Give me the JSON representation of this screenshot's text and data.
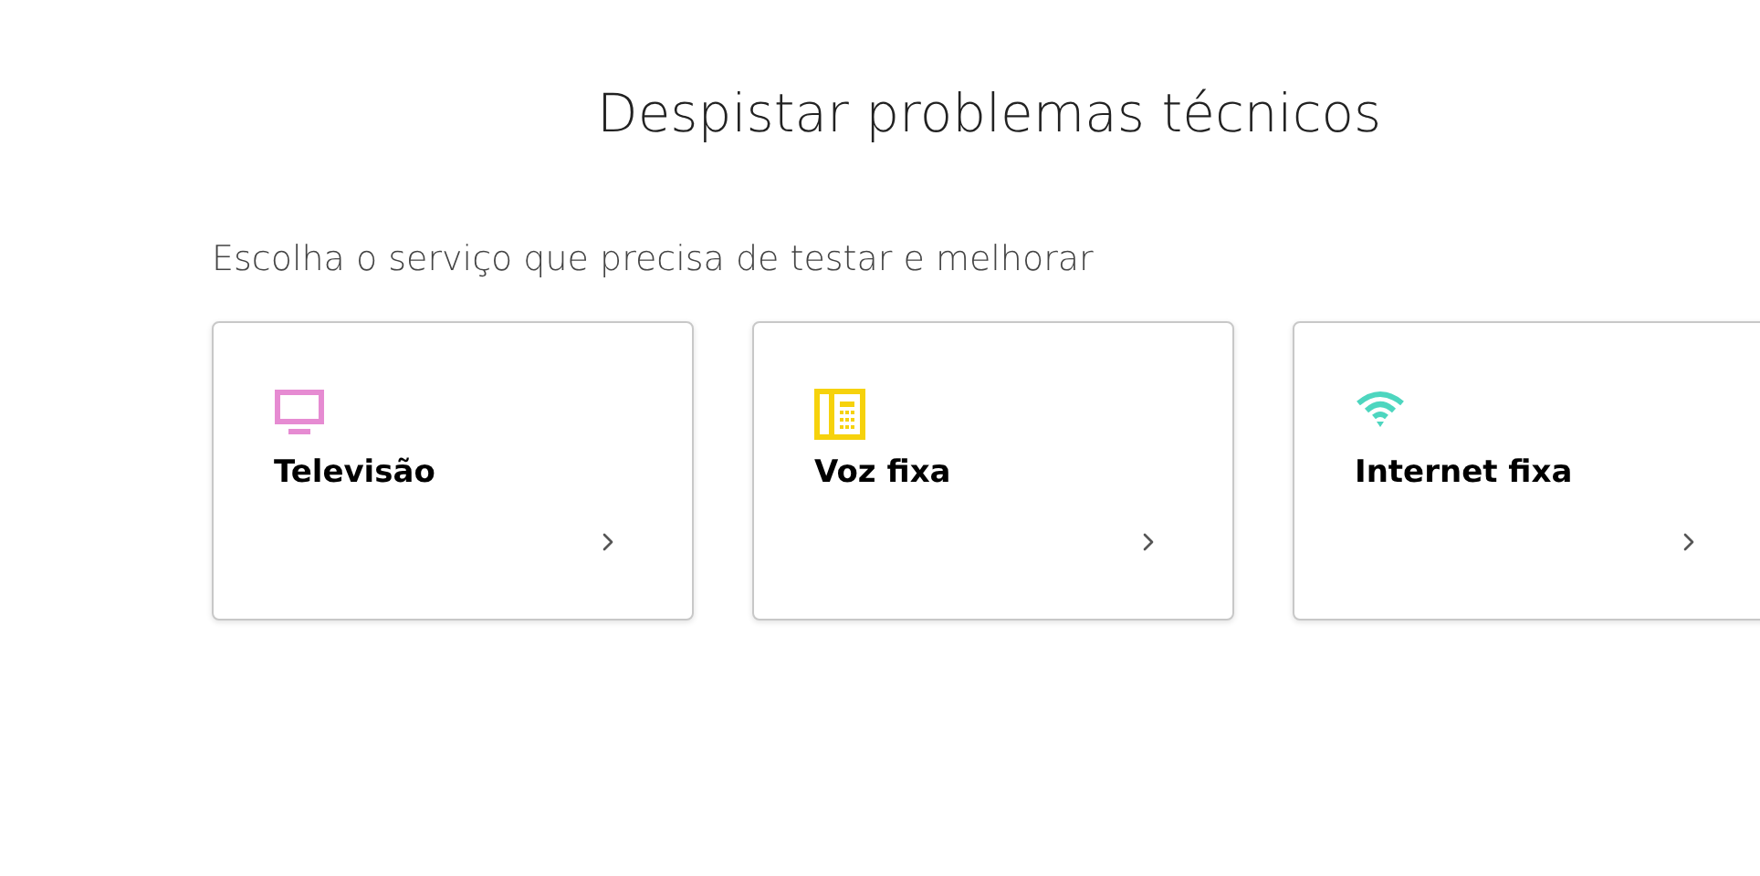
{
  "title": "Despistar problemas técnicos",
  "subtitle": "Escolha o serviço que precisa de testar e melhorar",
  "services": [
    {
      "kind": "tv",
      "label": "Televisão",
      "color": "#e68bd2"
    },
    {
      "kind": "phone",
      "label": "Voz fixa",
      "color": "#f6d20c"
    },
    {
      "kind": "wifi",
      "label": "Internet fixa",
      "color": "#4dd6bf"
    }
  ]
}
